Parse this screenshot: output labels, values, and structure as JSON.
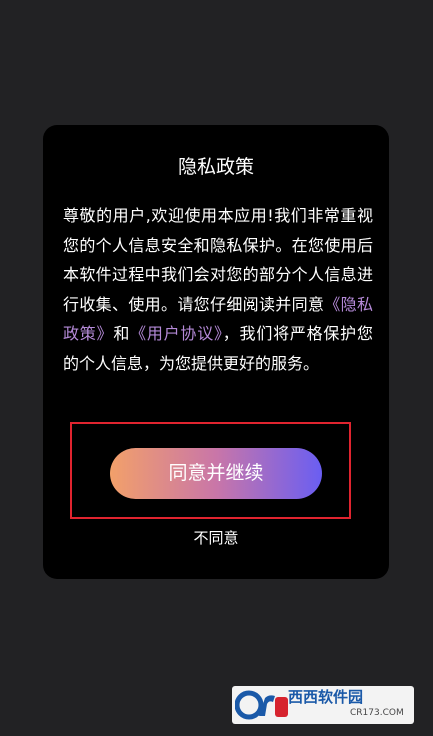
{
  "dialog": {
    "title": "隐私政策",
    "body_intro": "尊敬的用户,欢迎使用本应用!我们非常重视您的个人信息安全和隐私保护。在您使用后本软件过程中我们会对您的部分个人信息进行收集、使用。请您仔细阅读并同意",
    "privacy_link": "《隐私政策》",
    "conjunction": "和",
    "agreement_link": "《用户协议》",
    "body_outro": "，我们将严格保护您的个人信息，为您提供更好的服务。",
    "agree_button": "同意并继续",
    "disagree_link": "不同意"
  },
  "watermark": {
    "brand": "西西软件园",
    "domain": "CR173.COM"
  },
  "colors": {
    "background": "#222224",
    "dialog_background": "#000000",
    "link": "#b58ad8",
    "highlight_border": "#e0242f",
    "button_gradient_start": "#f2a06a",
    "button_gradient_end": "#6a5ef2"
  }
}
